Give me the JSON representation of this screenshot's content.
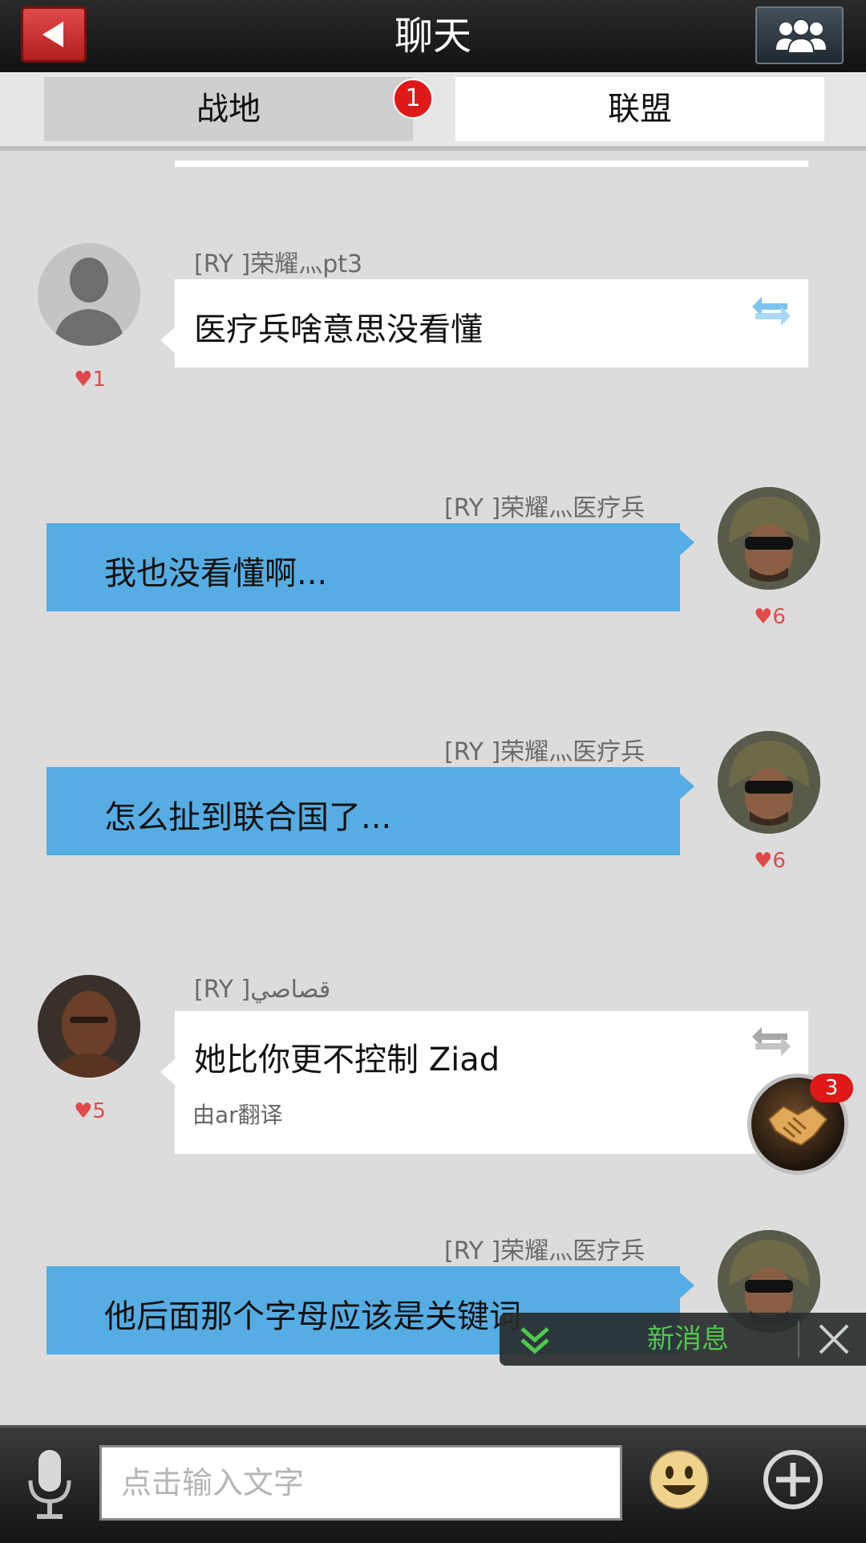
{
  "header": {
    "title": "聊天"
  },
  "tabs": [
    {
      "label": "战地",
      "badge": "1"
    },
    {
      "label": "联盟"
    }
  ],
  "messages": [
    {
      "sender": "[RY ]荣耀灬pt3",
      "text": "医疗兵啥意思没看懂",
      "likes": "1"
    },
    {
      "sender": "[RY ]荣耀灬医疗兵",
      "text": "我也没看懂啊...",
      "likes": "6"
    },
    {
      "sender": "[RY ]荣耀灬医疗兵",
      "text": "怎么扯到联合国了...",
      "likes": "6"
    },
    {
      "sender": "[RY ]قصاصي",
      "text": "她比你更不控制 Ziad",
      "translated_note": "由ar翻译",
      "likes": "5"
    },
    {
      "sender": "[RY ]荣耀灬医疗兵",
      "text": "他后面那个字母应该是关键词"
    }
  ],
  "alliance_float": {
    "badge": "3"
  },
  "new_message_bar": {
    "label": "新消息"
  },
  "input": {
    "placeholder": "点击输入文字"
  },
  "colors": {
    "outgoing_bubble": "#56ade3",
    "badge": "#e01818",
    "new_message_text": "#4fc84f"
  }
}
